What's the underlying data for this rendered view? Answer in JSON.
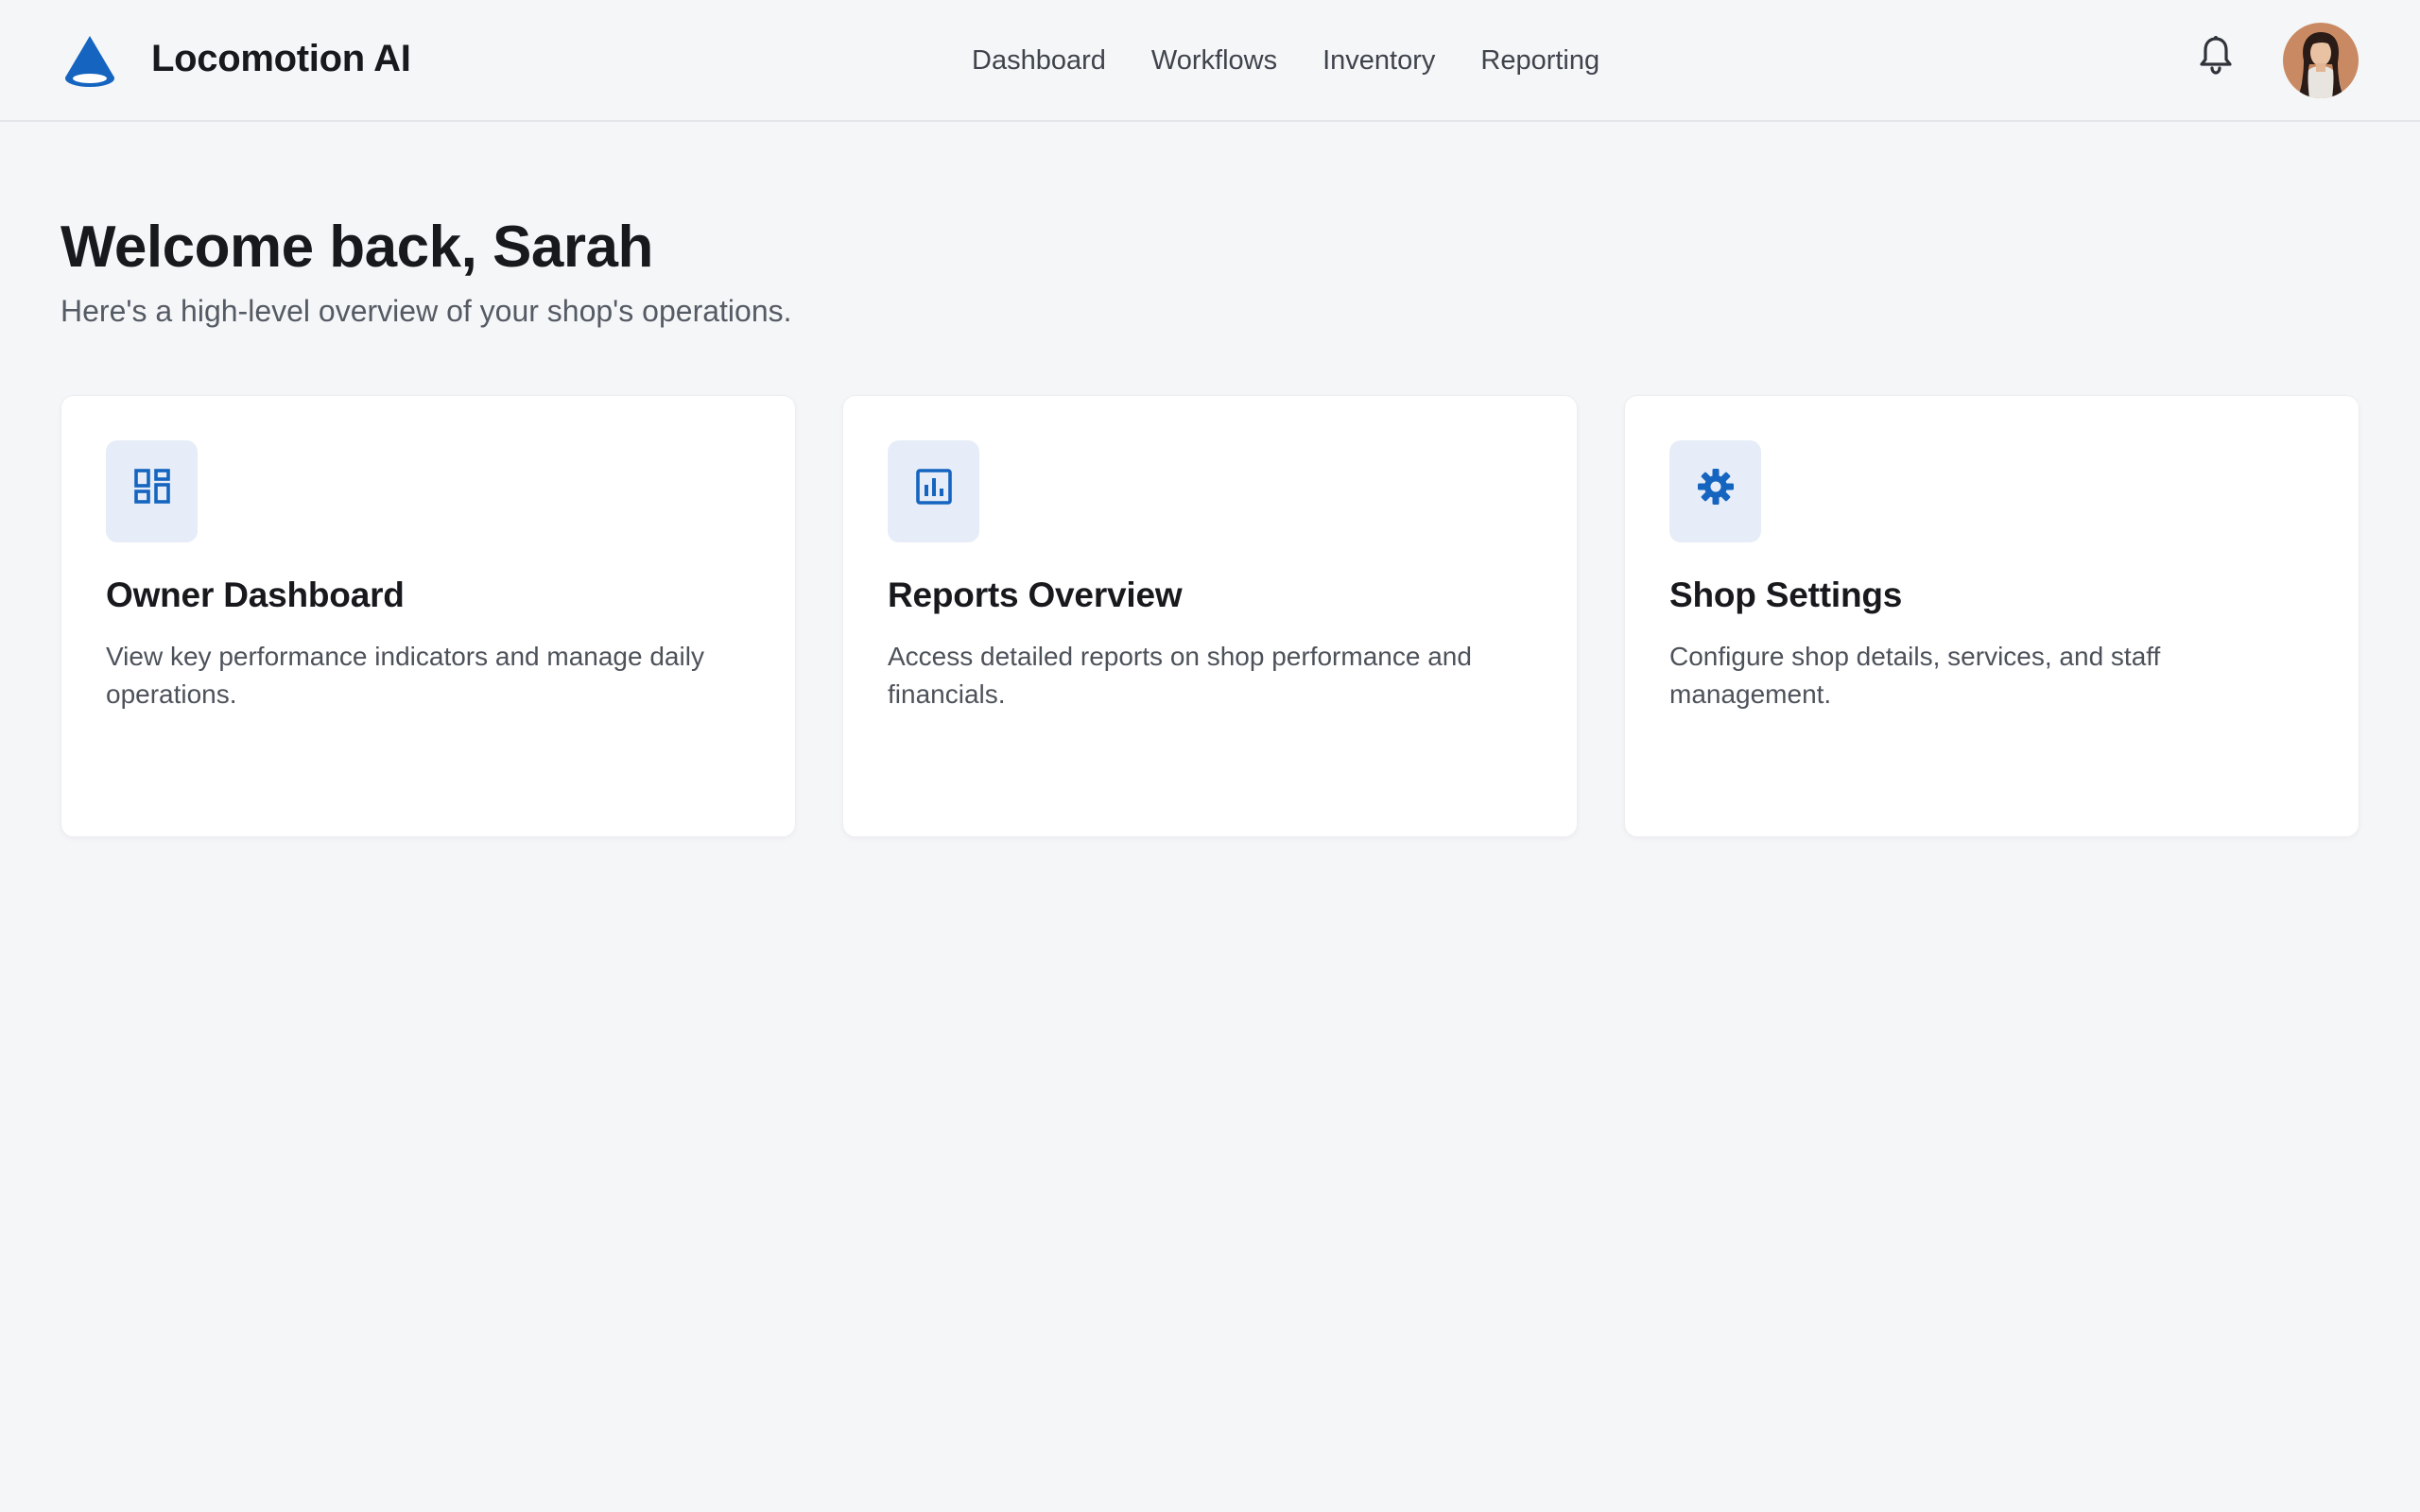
{
  "app": {
    "name": "Locomotion AI",
    "logo_icon": "cone-logo-icon",
    "accent_color": "#1565c0"
  },
  "nav": {
    "items": [
      {
        "label": "Dashboard"
      },
      {
        "label": "Workflows"
      },
      {
        "label": "Inventory"
      },
      {
        "label": "Reporting"
      }
    ]
  },
  "header": {
    "notifications_icon": "bell-icon",
    "avatar_icon": "user-avatar"
  },
  "main": {
    "welcome": "Welcome back, Sarah",
    "subtitle": "Here's a high-level overview of your shop's operations."
  },
  "cards": [
    {
      "icon": "dashboard-icon",
      "title": "Owner Dashboard",
      "description": "View key performance indicators and manage daily operations."
    },
    {
      "icon": "bar-chart-icon",
      "title": "Reports Overview",
      "description": "Access detailed reports on shop performance and financials."
    },
    {
      "icon": "gear-icon",
      "title": "Shop Settings",
      "description": "Configure shop details, services, and staff management."
    }
  ]
}
